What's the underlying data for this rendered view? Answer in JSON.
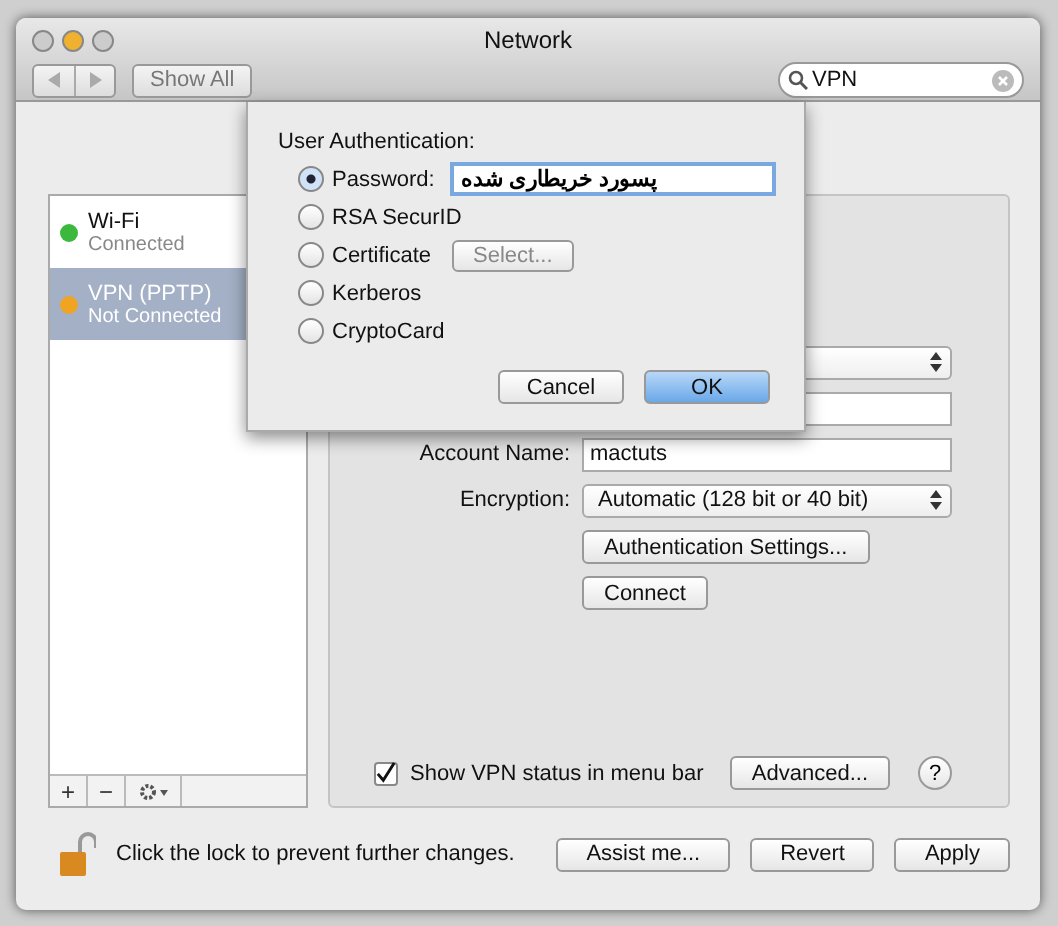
{
  "window": {
    "title": "Network",
    "show_all": "Show All",
    "search": "VPN"
  },
  "services": [
    {
      "name": "Wi-Fi",
      "status": "Connected",
      "color": "#3cb83c",
      "selected": false
    },
    {
      "name": "VPN (PPTP)",
      "status": "Not Connected",
      "color": "#f0a424",
      "selected": true
    }
  ],
  "list_tools": [
    "+",
    "−"
  ],
  "form": [
    {
      "kind": "popup"
    },
    {
      "kind": "field"
    },
    {
      "kind": "field",
      "label": "Account Name:",
      "value": "mactuts"
    },
    {
      "kind": "popup",
      "label": "Encryption:",
      "value": "Automatic (128 bit or 40 bit)"
    }
  ],
  "form_buttons": [
    "Authentication Settings...",
    "Connect"
  ],
  "show_status": {
    "label": "Show VPN status in menu bar",
    "checked": true
  },
  "advanced": "Advanced...",
  "help": "?",
  "lock_text": "Click the lock to prevent further changes.",
  "footer_buttons": [
    {
      "label": "Assist me..."
    },
    {
      "label": "Revert"
    },
    {
      "label": "Apply"
    }
  ],
  "sheet": {
    "heading": "User Authentication:",
    "options": [
      {
        "label": "Password:",
        "kind": "password",
        "selected": true
      },
      {
        "label": "RSA SecurID",
        "kind": "plain",
        "selected": false
      },
      {
        "label": "Certificate",
        "kind": "select",
        "selected": false
      },
      {
        "label": "Kerberos",
        "kind": "plain",
        "selected": false
      },
      {
        "label": "CryptoCard",
        "kind": "plain",
        "selected": false
      }
    ],
    "password": "پسورد خریطاری شده",
    "select_button": "Select...",
    "buttons": [
      {
        "label": "Cancel",
        "default": false
      },
      {
        "label": "OK",
        "default": true
      }
    ]
  }
}
